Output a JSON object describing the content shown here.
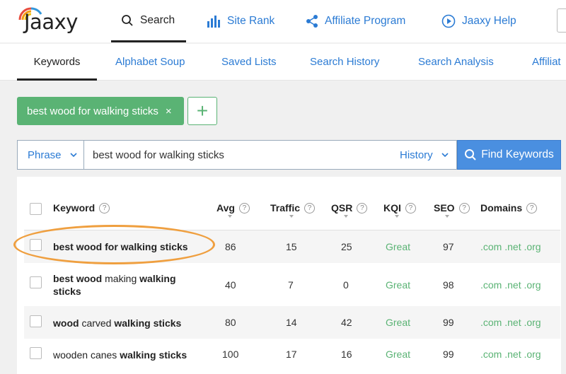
{
  "brand": {
    "name": "Jaaxy"
  },
  "topnav": [
    {
      "label": "Search",
      "icon": "search-icon",
      "active": true
    },
    {
      "label": "Site Rank",
      "icon": "bar-chart-icon"
    },
    {
      "label": "Affiliate Program",
      "icon": "share-icon"
    },
    {
      "label": "Jaaxy Help",
      "icon": "play-circle-icon"
    }
  ],
  "subnav": [
    "Keywords",
    "Alphabet Soup",
    "Saved Lists",
    "Search History",
    "Search Analysis",
    "Affiliat"
  ],
  "chip": {
    "label": "best wood for walking sticks",
    "close": "×"
  },
  "add_button": "+",
  "search": {
    "mode": "Phrase",
    "query": "best wood for walking sticks",
    "history": "History",
    "button": "Find Keywords"
  },
  "columns": [
    "Keyword",
    "Avg",
    "Traffic",
    "QSR",
    "KQI",
    "SEO",
    "Domains"
  ],
  "rows": [
    {
      "keyword": "best wood for walking sticks",
      "avg": "86",
      "traffic": "15",
      "qsr": "25",
      "kqi": "Great",
      "seo": "97",
      "domains": ".com .net .org"
    },
    {
      "keyword": "best wood making walking sticks",
      "avg": "40",
      "traffic": "7",
      "qsr": "0",
      "kqi": "Great",
      "seo": "98",
      "domains": ".com .net .org"
    },
    {
      "keyword": "wood carved walking sticks",
      "avg": "80",
      "traffic": "14",
      "qsr": "42",
      "kqi": "Great",
      "seo": "99",
      "domains": ".com .net .org"
    },
    {
      "keyword": "wooden canes walking sticks",
      "avg": "100",
      "traffic": "17",
      "qsr": "16",
      "kqi": "Great",
      "seo": "99",
      "domains": ".com .net .org"
    }
  ],
  "colors": {
    "accent_blue": "#2b7bd4",
    "button_blue": "#4a8fe0",
    "green": "#5ab374",
    "highlight_orange": "#ef9f3f"
  }
}
